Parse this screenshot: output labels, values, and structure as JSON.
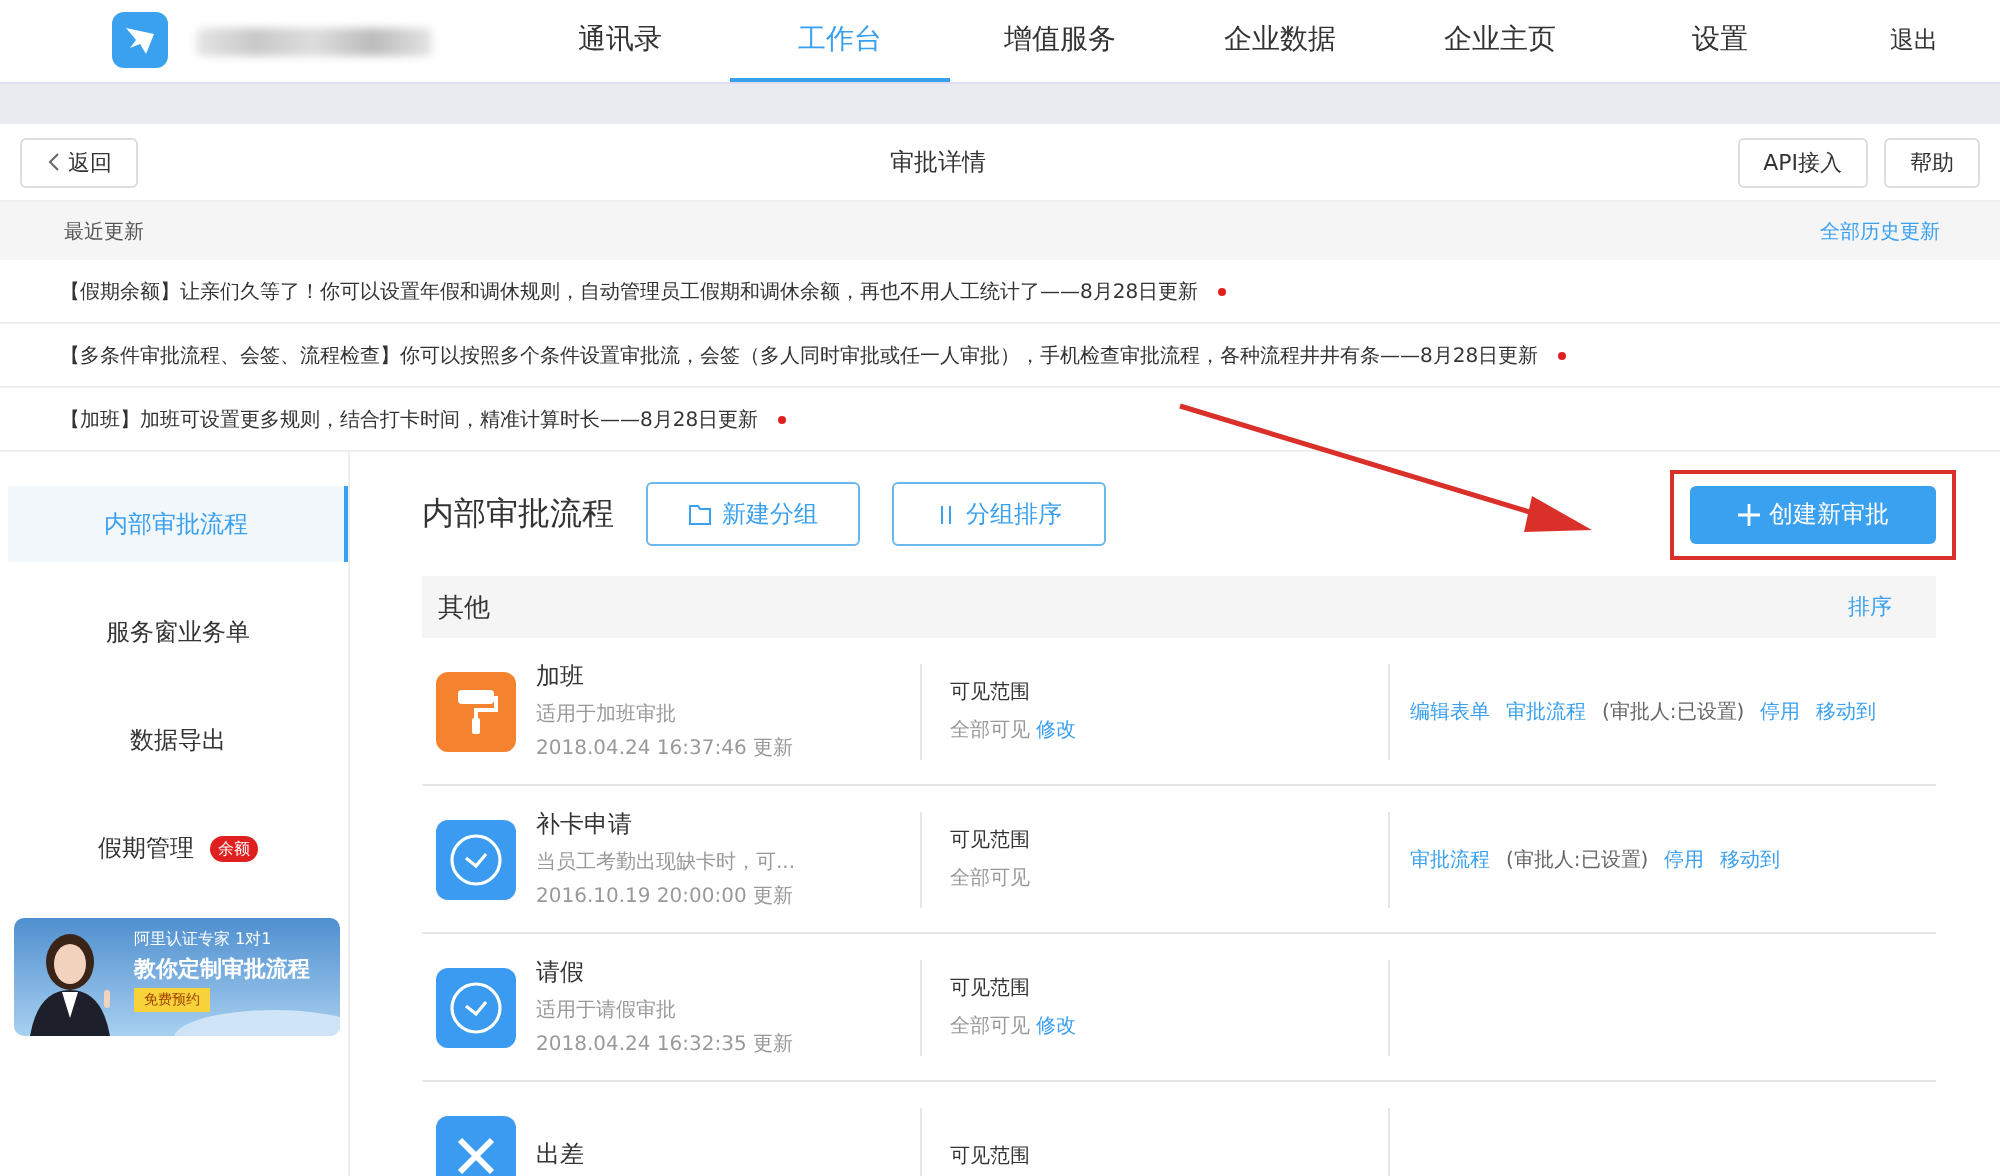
{
  "nav": {
    "tabs": [
      {
        "label": "通讯录",
        "selected": false
      },
      {
        "label": "工作台",
        "selected": true
      },
      {
        "label": "增值服务",
        "selected": false
      },
      {
        "label": "企业数据",
        "selected": false
      },
      {
        "label": "企业主页",
        "selected": false
      },
      {
        "label": "设置",
        "selected": false
      }
    ],
    "logout": "退出"
  },
  "header": {
    "back": "返回",
    "title": "审批详情",
    "buttons": [
      "API接入",
      "帮助"
    ]
  },
  "updates": {
    "title": "最近更新",
    "history_link": "全部历史更新",
    "items": [
      {
        "tag": "【假期余额】",
        "text": "让亲们久等了！你可以设置年假和调休规则，自动管理员工假期和调休余额，再也不用人工统计了——8月28日更新",
        "unread": true
      },
      {
        "tag": "【多条件审批流程、会签、流程检查】",
        "text": "你可以按照多个条件设置审批流，会签（多人同时审批或任一人审批），手机检查审批流程，各种流程井井有条——8月28日更新",
        "unread": true
      },
      {
        "tag": "【加班】",
        "text": "加班可设置更多规则，结合打卡时间，精准计算时长——8月28日更新",
        "unread": true
      }
    ]
  },
  "sidebar": {
    "items": [
      {
        "label": "内部审批流程",
        "selected": true
      },
      {
        "label": "服务窗业务单",
        "selected": false
      },
      {
        "label": "数据导出",
        "selected": false
      },
      {
        "label": "假期管理",
        "selected": false,
        "badge": "余额"
      }
    ],
    "banner": {
      "line1": "阿里认证专家 1对1",
      "line2": "教你定制审批流程",
      "button": "免费预约"
    }
  },
  "main": {
    "title": "内部审批流程",
    "buttons": [
      "新建分组",
      "分组排序"
    ],
    "create_button": {
      "label": "创建新审批",
      "highlighted": true
    },
    "group": {
      "name": "其他",
      "sort_link": "排序"
    },
    "rows": [
      {
        "name": "加班",
        "description": "适用于加班审批",
        "updated": "2018.04.24 16:37:46 更新",
        "visibility_label": "可见范围",
        "visibility": "全部可见",
        "edit_link": "修改",
        "actions": [
          {
            "kind": "link",
            "text": "编辑表单"
          },
          {
            "kind": "link",
            "text": "审批流程"
          },
          {
            "kind": "note",
            "text": "(审批人:已设置)"
          },
          {
            "kind": "link",
            "text": "停用"
          },
          {
            "kind": "link",
            "text": "移动到"
          }
        ]
      },
      {
        "name": "补卡申请",
        "description": "当员工考勤出现缺卡时，可...",
        "updated": "2016.10.19 20:00:00 更新",
        "visibility_label": "可见范围",
        "visibility": "全部可见",
        "actions": [
          {
            "kind": "link",
            "text": "审批流程"
          },
          {
            "kind": "note",
            "text": "(审批人:已设置)"
          },
          {
            "kind": "link",
            "text": "停用"
          },
          {
            "kind": "link",
            "text": "移动到"
          }
        ]
      },
      {
        "name": "请假",
        "description": "适用于请假审批",
        "updated": "2018.04.24 16:32:35 更新",
        "visibility_label": "可见范围",
        "visibility": "全部可见",
        "edit_link": "修改",
        "actions": []
      },
      {
        "name": "出差",
        "visibility_label": "可见范围",
        "actions": []
      }
    ]
  }
}
